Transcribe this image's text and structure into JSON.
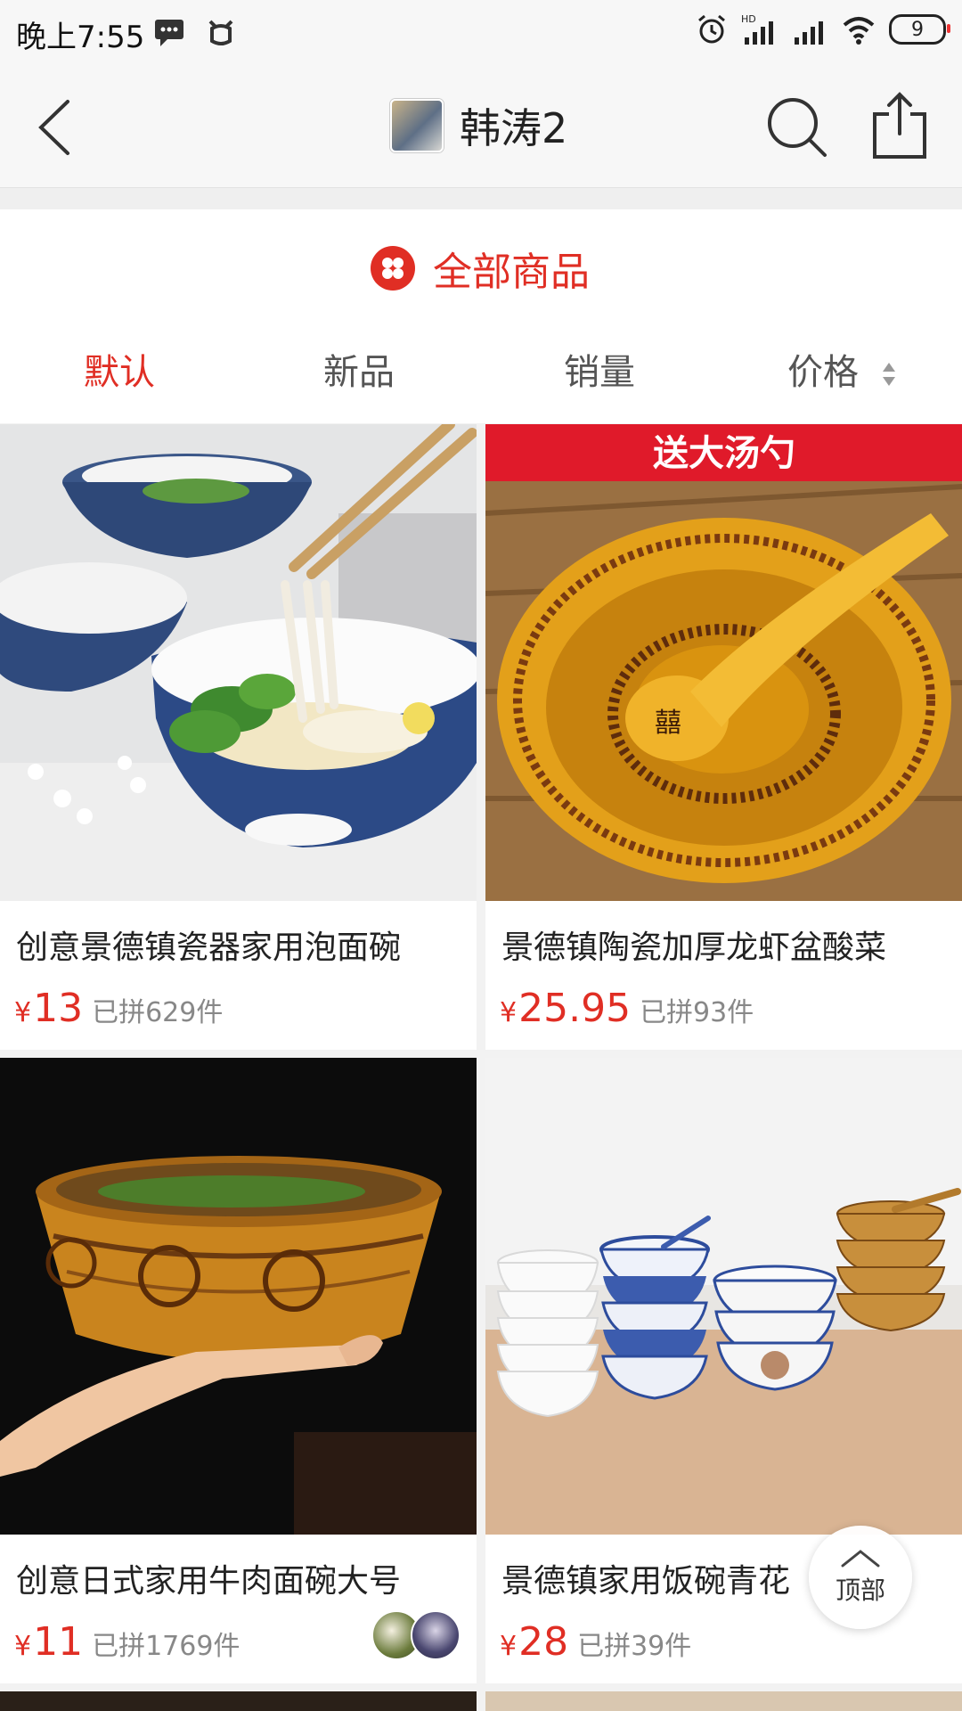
{
  "status_bar": {
    "time": "晚上7:55",
    "battery": "9"
  },
  "header": {
    "shop_name": "韩涛2",
    "icons": [
      "back-arrow-icon",
      "search-icon",
      "share-icon"
    ]
  },
  "section": {
    "title": "全部商品",
    "sort_tabs": [
      "默认",
      "新品",
      "销量",
      "价格"
    ],
    "active_tab": "默认"
  },
  "products": [
    {
      "title": "创意景德镇瓷器家用泡面碗",
      "price": "13",
      "sold": "已拼629件"
    },
    {
      "title": "景德镇陶瓷加厚龙虾盆酸菜",
      "price": "25.95",
      "sold": "已拼93件",
      "badge": "送大汤勺"
    },
    {
      "title": "创意日式家用牛肉面碗大号",
      "price": "11",
      "sold": "已拼1769件"
    },
    {
      "title": "景德镇家用饭碗青花",
      "price": "28",
      "sold": "已拼39件"
    }
  ],
  "currency_symbol": "¥",
  "back_to_top": "顶部",
  "colors": {
    "accent": "#e02e24"
  }
}
